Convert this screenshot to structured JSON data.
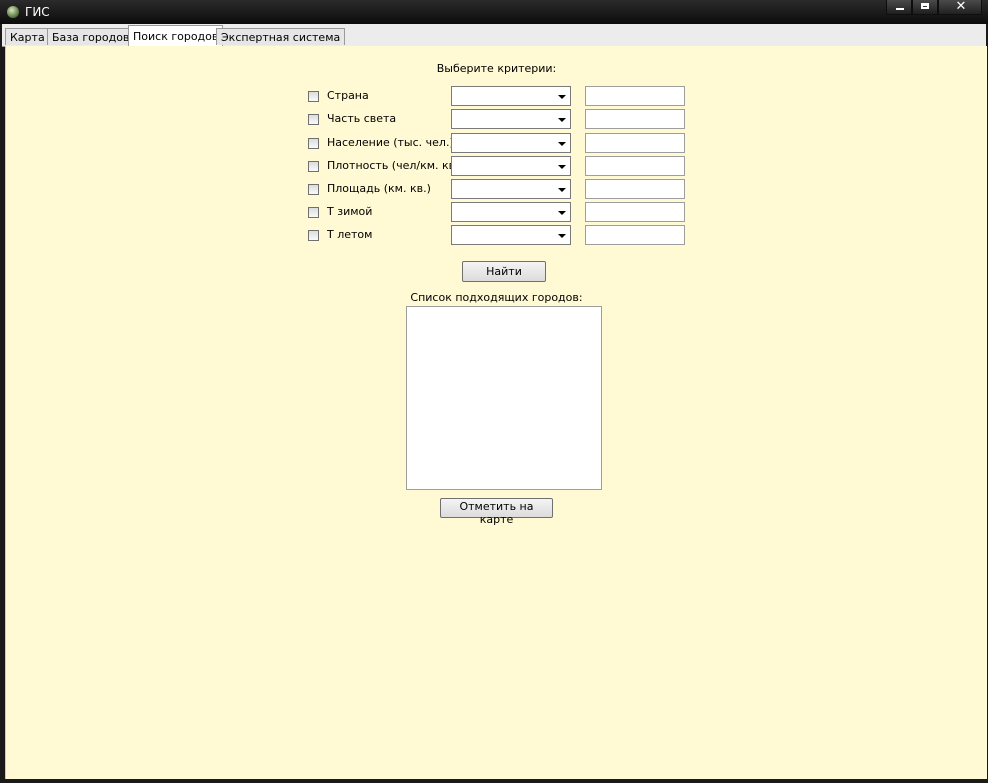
{
  "window": {
    "title": "ГИС",
    "close_glyph": "✕"
  },
  "tabs": [
    {
      "label": "Карта"
    },
    {
      "label": "База городов"
    },
    {
      "label": "Поиск городов"
    },
    {
      "label": "Экспертная система"
    }
  ],
  "search": {
    "criteria_header": "Выберите критерии:",
    "criteria": [
      {
        "label": "Страна",
        "checked": false,
        "combo_value": "",
        "value": ""
      },
      {
        "label": "Часть света",
        "checked": false,
        "combo_value": "",
        "value": ""
      },
      {
        "label": "Население (тыс. чел.)",
        "checked": false,
        "combo_value": "",
        "value": ""
      },
      {
        "label": "Плотность (чел/км. кв.)",
        "checked": false,
        "combo_value": "",
        "value": ""
      },
      {
        "label": "Площадь (км. кв.)",
        "checked": false,
        "combo_value": "",
        "value": ""
      },
      {
        "label": "Т зимой",
        "checked": false,
        "combo_value": "",
        "value": ""
      },
      {
        "label": "Т летом",
        "checked": false,
        "combo_value": "",
        "value": ""
      }
    ],
    "find_button": "Найти",
    "results_label": "Список подходящих городов:",
    "results": [],
    "mark_button": "Отметить на карте"
  },
  "colors": {
    "content_bg": "#fff9d4",
    "titlebar": "#111111"
  }
}
